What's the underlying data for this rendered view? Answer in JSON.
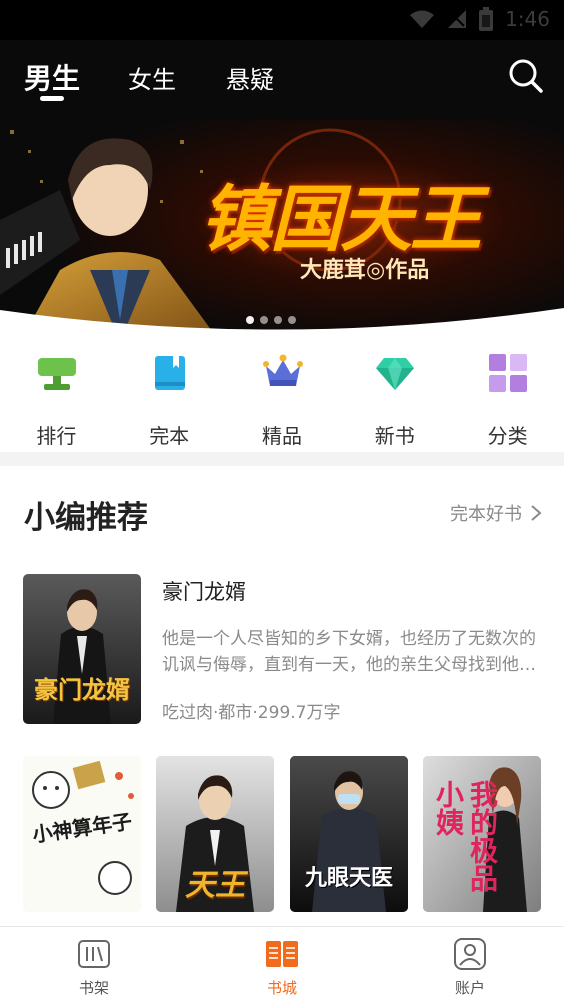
{
  "status_bar": {
    "time": "1:46"
  },
  "tabs": [
    {
      "label": "男生",
      "active": true
    },
    {
      "label": "女生",
      "active": false
    },
    {
      "label": "悬疑",
      "active": false
    }
  ],
  "banner": {
    "title": "镇国天王",
    "subtitle": "大鹿茸◎作品",
    "slide_count": 4,
    "active_slide": 1
  },
  "categories": [
    {
      "label": "排行",
      "icon": "trophy-icon",
      "color": "#6cc24a"
    },
    {
      "label": "完本",
      "icon": "book-icon",
      "color": "#2ab0e8"
    },
    {
      "label": "精品",
      "icon": "crown-icon",
      "color": "#5b6fd8"
    },
    {
      "label": "新书",
      "icon": "diamond-icon",
      "color": "#2fcfa5"
    },
    {
      "label": "分类",
      "icon": "grid-icon",
      "color": "#b27fe0"
    }
  ],
  "section": {
    "title": "小编推荐",
    "more_label": "完本好书"
  },
  "featured_book": {
    "title": "豪门龙婿",
    "description": "他是一个人尽皆知的乡下女婿，也经历了无数次的讥讽与侮辱，直到有一天，他的亲生父母找到他…",
    "meta": "吃过肉·都市·299.7万字",
    "cover_text": "豪门龙婿"
  },
  "books": [
    {
      "cover_text": "小神算年子"
    },
    {
      "cover_text": "天王"
    },
    {
      "cover_text": "九眼天医"
    },
    {
      "cover_text": "我的极品小姨"
    }
  ],
  "bottom_nav": [
    {
      "label": "书架",
      "icon": "bookshelf-icon",
      "active": false
    },
    {
      "label": "书城",
      "icon": "bookstore-icon",
      "active": true
    },
    {
      "label": "账户",
      "icon": "account-icon",
      "active": false
    }
  ],
  "colors": {
    "accent": "#f26b1d",
    "header_bg": "#0a0a0a",
    "banner_title": "#ffb400"
  }
}
